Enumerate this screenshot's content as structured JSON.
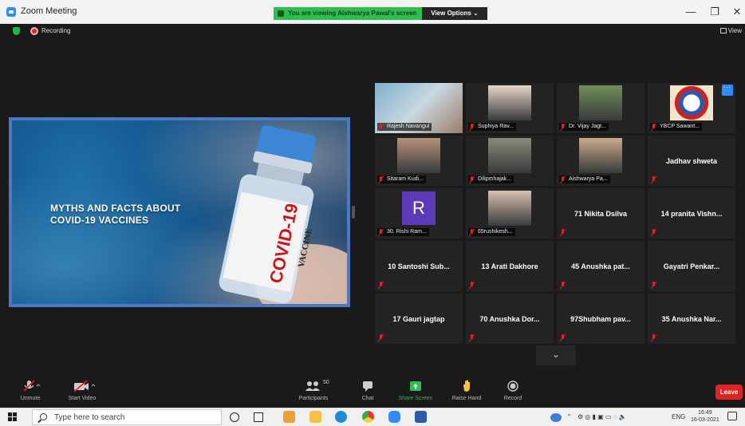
{
  "window": {
    "title": "Zoom Meeting",
    "share_banner": "You are viewing Aishwarya Pawal's screen",
    "view_options": "View Options ⌄",
    "minimize": "—",
    "restore": "❐",
    "close": "✕"
  },
  "status": {
    "recording": "Recording",
    "view": "View"
  },
  "slide": {
    "line1": "MYTHS AND FACTS ABOUT",
    "line2": "COVID-19 VACCINES",
    "vial_title": "COVID-19",
    "vial_sub": "VACCINE"
  },
  "participants": [
    {
      "label": "Rajesh Navangul",
      "kind": "video"
    },
    {
      "label": "Suphiya Rav...",
      "kind": "photo"
    },
    {
      "label": "Dr. Vijay Jagt...",
      "kind": "photo"
    },
    {
      "label": "YBCP Sawant...",
      "kind": "logo"
    },
    {
      "label": "Sitaram Kudi...",
      "kind": "photo"
    },
    {
      "label": "Dilipmhajak...",
      "kind": "photo"
    },
    {
      "label": "Aishwarya Pa...",
      "kind": "photo"
    },
    {
      "name": "Jadhav shweta",
      "kind": "name"
    },
    {
      "label": "30. Rishi Ram...",
      "kind": "avatar",
      "initial": "R"
    },
    {
      "label": "65rushikesh...",
      "kind": "photo"
    },
    {
      "name": "71 Nikita Dsilva",
      "kind": "name"
    },
    {
      "name": "14 pranita Vishn...",
      "kind": "name"
    },
    {
      "name": "10 Santoshi Sub...",
      "kind": "name"
    },
    {
      "name": "13 Arati Dakhore",
      "kind": "name"
    },
    {
      "name": "45 Anushka pat...",
      "kind": "name"
    },
    {
      "name": "Gayatri Penkar...",
      "kind": "name"
    },
    {
      "name": "17 Gauri jagtap",
      "kind": "name"
    },
    {
      "name": "70 Anushka Dor...",
      "kind": "name"
    },
    {
      "name": "97Shubham pav...",
      "kind": "name"
    },
    {
      "name": "35 Anushka Nar...",
      "kind": "name"
    }
  ],
  "toolbar": {
    "unmute": "Unmute",
    "start_video": "Start Video",
    "participants": "Participants",
    "participants_count": "50",
    "chat": "Chat",
    "share_screen": "Share Screen",
    "raise_hand": "Raise Hand",
    "record": "Record",
    "leave": "Leave"
  },
  "taskbar": {
    "search_placeholder": "Type here to search",
    "lang": "ENG",
    "time": "16:49",
    "date": "16-03-2021"
  },
  "colors": {
    "accent": "#2d8cff",
    "share_green": "#2ebd4f",
    "leave_red": "#e02424",
    "active_speaker": "#a6d83e"
  }
}
